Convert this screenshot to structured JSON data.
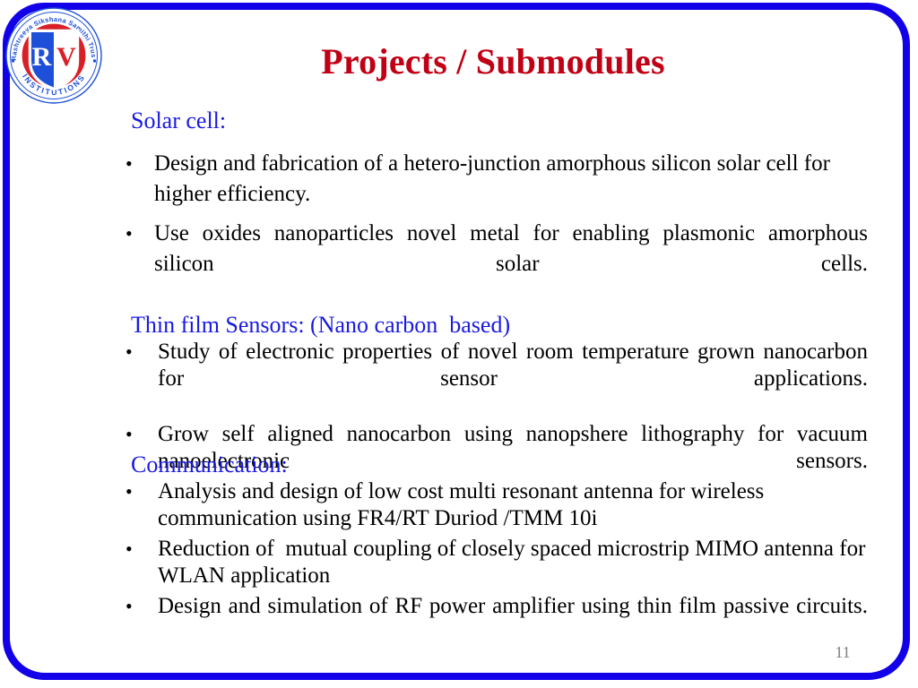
{
  "slide": {
    "title": "Projects / Submodules",
    "page_number": "11",
    "accent_blue": "#1200e8",
    "title_red": "#c00014",
    "heading_blue": "#1a1ae0",
    "page_number_gray": "#808080"
  },
  "logo": {
    "alt": "RV Institutions emblem",
    "arc_top_text": "Rashtreeya Sikshana Samithi Trust",
    "arc_bottom_text": "INSTITUTIONS",
    "monogram": "RV",
    "ring_red": "#d72027",
    "shield_blue": "#1d4fd8",
    "shield_red": "#d72027"
  },
  "sections": [
    {
      "heading": "Solar cell:",
      "bullets": [
        "Design and fabrication of a hetero-junction amorphous silicon solar cell for higher efficiency.",
        "Use oxides nanoparticles novel metal for enabling plasmonic amorphous silicon solar cells."
      ]
    },
    {
      "heading": "Thin film Sensors: (Nano carbon  based)",
      "bullets": [
        "Study of electronic properties of novel room temperature grown nanocarbon for sensor applications.",
        "Grow self aligned nanocarbon using nanopshere lithography for vacuum nanoelectronic sensors."
      ]
    },
    {
      "heading": "Communication:",
      "bullets": [
        "Analysis and design of low cost multi resonant antenna for wireless communication using FR4/RT Duriod /TMM 10i",
        "Reduction of  mutual coupling of closely spaced microstrip MIMO antenna for WLAN application",
        "Design and simulation of RF power amplifier using thin film passive circuits."
      ]
    }
  ],
  "bullet_glyph": "•"
}
